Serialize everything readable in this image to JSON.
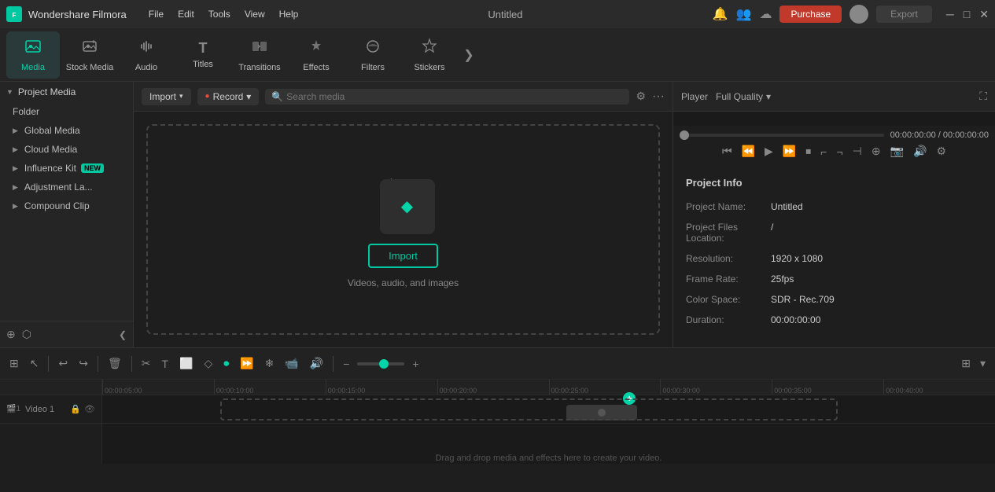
{
  "app": {
    "name": "Wondershare Filmora",
    "title": "Untitled"
  },
  "titlebar": {
    "menu_items": [
      "File",
      "Edit",
      "Tools",
      "View",
      "Help"
    ],
    "purchase_label": "Purchase",
    "export_label": "Export"
  },
  "toolbar": {
    "items": [
      {
        "id": "media",
        "label": "Media",
        "icon": "🎬",
        "active": true
      },
      {
        "id": "stock-media",
        "label": "Stock Media",
        "icon": "📷"
      },
      {
        "id": "audio",
        "label": "Audio",
        "icon": "🎵"
      },
      {
        "id": "titles",
        "label": "Titles",
        "icon": "T"
      },
      {
        "id": "transitions",
        "label": "Transitions",
        "icon": "⟷"
      },
      {
        "id": "effects",
        "label": "Effects",
        "icon": "✨"
      },
      {
        "id": "filters",
        "label": "Filters",
        "icon": "🎨"
      },
      {
        "id": "stickers",
        "label": "Stickers",
        "icon": "⭐"
      }
    ],
    "more_icon": "❯"
  },
  "sidebar": {
    "items": [
      {
        "id": "project-media",
        "label": "Project Media",
        "active": true,
        "expanded": true
      },
      {
        "id": "folder",
        "label": "Folder"
      },
      {
        "id": "global-media",
        "label": "Global Media"
      },
      {
        "id": "cloud-media",
        "label": "Cloud Media"
      },
      {
        "id": "influence-kit",
        "label": "Influence Kit",
        "badge": "NEW"
      },
      {
        "id": "adjustment-la",
        "label": "Adjustment La..."
      },
      {
        "id": "compound-clip",
        "label": "Compound Clip"
      }
    ],
    "bottom_icons": [
      "+",
      "⬡"
    ],
    "collapse_icon": "❮"
  },
  "media_panel": {
    "import_label": "Import",
    "record_label": "Record",
    "search_placeholder": "Search media",
    "drop_text": "Videos, audio, and images",
    "import_button_label": "Import",
    "filter_icon": "≡",
    "more_icon": "···"
  },
  "player": {
    "tab_label": "Player",
    "quality_label": "Full Quality",
    "time_current": "00:00:00:00",
    "time_total": "00:00:00:00",
    "progress_value": 0
  },
  "project_info": {
    "title": "Project Info",
    "name_label": "Project Name:",
    "name_value": "Untitled",
    "files_label": "Project Files Location:",
    "files_value": "/",
    "resolution_label": "Resolution:",
    "resolution_value": "1920 x 1080",
    "framerate_label": "Frame Rate:",
    "framerate_value": "25fps",
    "colorspace_label": "Color Space:",
    "colorspace_value": "SDR - Rec.709",
    "duration_label": "Duration:",
    "duration_value": "00:00:00:00"
  },
  "timeline": {
    "ruler_marks": [
      "00:00:05:00",
      "00:00:10:00",
      "00:00:15:00",
      "00:00:20:00",
      "00:00:25:00",
      "00:00:30:00",
      "00:00:35:00",
      "00:00:40:00"
    ],
    "drag_text": "Drag and drop media and effects here to create your video.",
    "track_label": "Video 1",
    "toolbar_buttons": [
      {
        "id": "scene-detect",
        "icon": "⊞"
      },
      {
        "id": "cursor",
        "icon": "↖"
      },
      {
        "separator": true
      },
      {
        "id": "undo",
        "icon": "↩"
      },
      {
        "id": "redo",
        "icon": "↪"
      },
      {
        "separator": true
      },
      {
        "id": "delete",
        "icon": "🗑"
      },
      {
        "separator": true
      },
      {
        "id": "cut",
        "icon": "✂"
      },
      {
        "id": "text",
        "icon": "T"
      },
      {
        "id": "crop",
        "icon": "⬜"
      },
      {
        "id": "keyframe",
        "icon": "◇"
      },
      {
        "id": "ripple",
        "icon": "⊙"
      },
      {
        "id": "record",
        "icon": "⏺",
        "active": true
      },
      {
        "id": "speed",
        "icon": "⏩"
      },
      {
        "id": "freeze",
        "icon": "❄"
      },
      {
        "id": "video",
        "icon": "📹"
      },
      {
        "id": "audio",
        "icon": "🔊"
      },
      {
        "separator": true
      },
      {
        "id": "zoom-out",
        "icon": "−"
      },
      {
        "id": "zoom-in",
        "icon": "+"
      }
    ],
    "zoom_value": 65,
    "right_toolbar": [
      {
        "id": "grid",
        "icon": "⊞"
      },
      {
        "id": "more",
        "icon": "▾"
      }
    ]
  }
}
